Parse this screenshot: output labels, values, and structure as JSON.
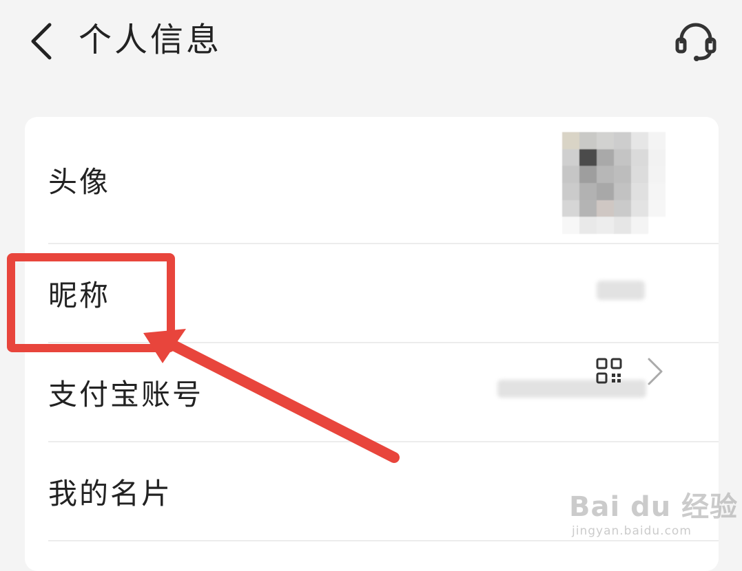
{
  "header": {
    "title": "个人信息",
    "back_icon": "chevron-left-icon",
    "service_icon": "headset-icon"
  },
  "rows": [
    {
      "label": "头像",
      "value_type": "avatar"
    },
    {
      "label": "昵称",
      "value_type": "blurred-text"
    },
    {
      "label": "支付宝账号",
      "value_type": "blurred-text"
    },
    {
      "label": "我的名片",
      "value_type": "qr-code-chevron"
    }
  ],
  "annotation": {
    "highlight_color": "#e8453c",
    "highlighted_row": "昵称"
  },
  "watermark": {
    "main": "Bai du 经验",
    "sub": "jingyan.baidu.com"
  }
}
